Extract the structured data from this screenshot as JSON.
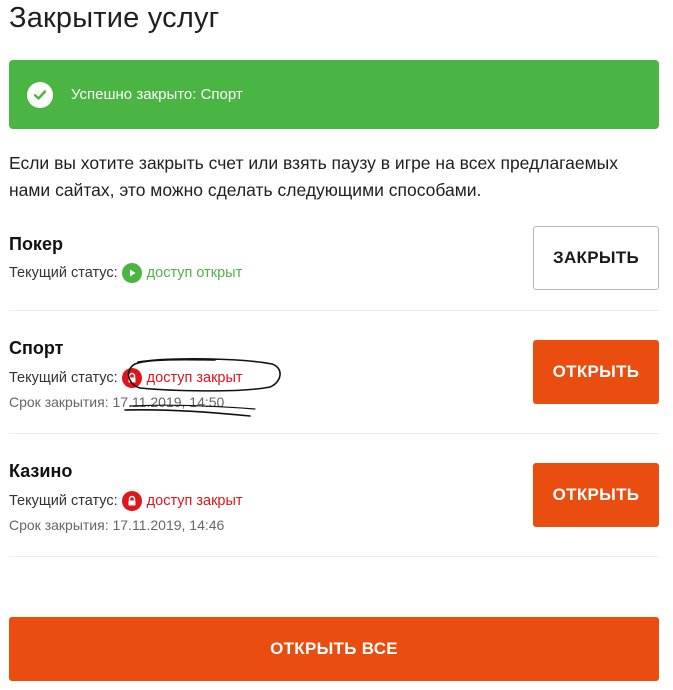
{
  "page": {
    "title": "Закрытие услуг"
  },
  "alert": {
    "text": "Успешно закрыто: Спорт",
    "color": "#4bb543"
  },
  "intro": {
    "text": "Если вы хотите закрыть счет или взять паузу в игре на всех предлагаемых нами сайтах, это можно сделать следующими способами."
  },
  "services": [
    {
      "name": "Покер",
      "status_label": "Текущий статус:",
      "status_value": "доступ открыт",
      "status": "open",
      "button_label": "ЗАКРЫТЬ"
    },
    {
      "name": "Спорт",
      "status_label": "Текущий статус:",
      "status_value": "доступ закрыт",
      "status": "closed",
      "date_label": "Срок закрытия:",
      "date_value": "17.11.2019, 14:50",
      "button_label": "ОТКРЫТЬ"
    },
    {
      "name": "Казино",
      "status_label": "Текущий статус:",
      "status_value": "доступ закрыт",
      "status": "closed",
      "date_label": "Срок закрытия:",
      "date_value": "17.11.2019, 14:46",
      "button_label": "ОТКРЫТЬ"
    }
  ],
  "footer": {
    "open_all_label": "ОТКРЫТЬ ВСЕ"
  },
  "colors": {
    "accent": "#e94d10",
    "success": "#4bb543",
    "danger": "#e0141b"
  },
  "icons": {
    "alert": "check-circle-icon",
    "open_status": "play-icon",
    "closed_status": "lock-icon"
  }
}
